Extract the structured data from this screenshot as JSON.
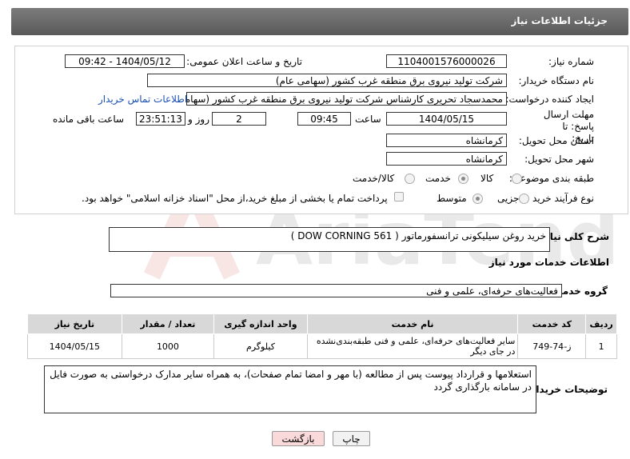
{
  "header": {
    "title": "جزئیات اطلاعات نیاز"
  },
  "form": {
    "need_number_label": "شماره نیاز:",
    "need_number": "1104001576000026",
    "announce_label": "تاریخ و ساعت اعلان عمومی:",
    "announce_value": "1404/05/12 - 09:42",
    "buyer_label": "نام دستگاه خریدار:",
    "buyer_value": "شرکت تولید نیروی برق منطقه غرب کشور (سهامی عام)",
    "creator_label": "ایجاد کننده درخواست:",
    "creator_value": "محمدسجاد تحریری کارشناس شرکت تولید نیروی برق منطقه غرب کشور (سهامی عام)",
    "contact_link": "اطلاعات تماس خریدار",
    "deadline_label": "مهلت ارسال پاسخ: تا تاریخ:",
    "deadline_date": "1404/05/15",
    "time_label": "ساعت",
    "deadline_time": "09:45",
    "days_value": "2",
    "days_label": "روز و",
    "remaining_time": "23:51:13",
    "remaining_label": "ساعت باقی مانده",
    "province_label": "استان محل تحویل:",
    "province_value": "کرمانشاه",
    "city_label": "شهر محل تحویل:",
    "city_value": "کرمانشاه",
    "category_label": "طبقه بندی موضوعی:",
    "category_options": [
      "کالا",
      "خدمت",
      "کالا/خدمت"
    ],
    "category_selected": 1,
    "process_label": "نوع فرآیند خرید :",
    "process_options": [
      "جزیی",
      "متوسط"
    ],
    "process_selected": 1,
    "payment_note": "پرداخت تمام یا بخشی از مبلغ خرید،از محل \"اسناد خزانه اسلامی\" خواهد بود."
  },
  "summary": {
    "label": "شرح کلی نیاز:",
    "value": "خرید روغن سیلیکونی ترانسفورماتور ( DOW CORNING 561 )"
  },
  "services": {
    "section_title": "اطلاعات خدمات مورد نیاز",
    "group_label": "گروه خدمت:",
    "group_value": "فعالیت‌های حرفه‌ای، علمی و فنی",
    "columns": [
      "ردیف",
      "کد خدمت",
      "نام خدمت",
      "واحد اندازه گیری",
      "تعداد / مقدار",
      "تاریخ نیاز"
    ],
    "rows": [
      {
        "row": "1",
        "code": "ز-74-749",
        "name": "سایر فعالیت‌های حرفه‌ای، علمی و فنی طبقه‌بندی‌نشده در جای دیگر",
        "unit": "کیلوگرم",
        "qty": "1000",
        "date": "1404/05/15"
      }
    ]
  },
  "buyer_notes": {
    "label": "توضیحات خریدار:",
    "value": "استعلامها و قرارداد پیوست پس از مطالعه (با مهر و امضا تمام صفحات)، به همراه سایر مدارک درخواستی به صورت فایل در سامانه بارگذاری گردد"
  },
  "buttons": {
    "print": "چاپ",
    "back": "بازگشت"
  },
  "watermark_text": "AriaTender.net",
  "colors": {
    "header_bg": "#666666",
    "link": "#1a4fb5",
    "back_button_bg": "#f9d9d9"
  }
}
